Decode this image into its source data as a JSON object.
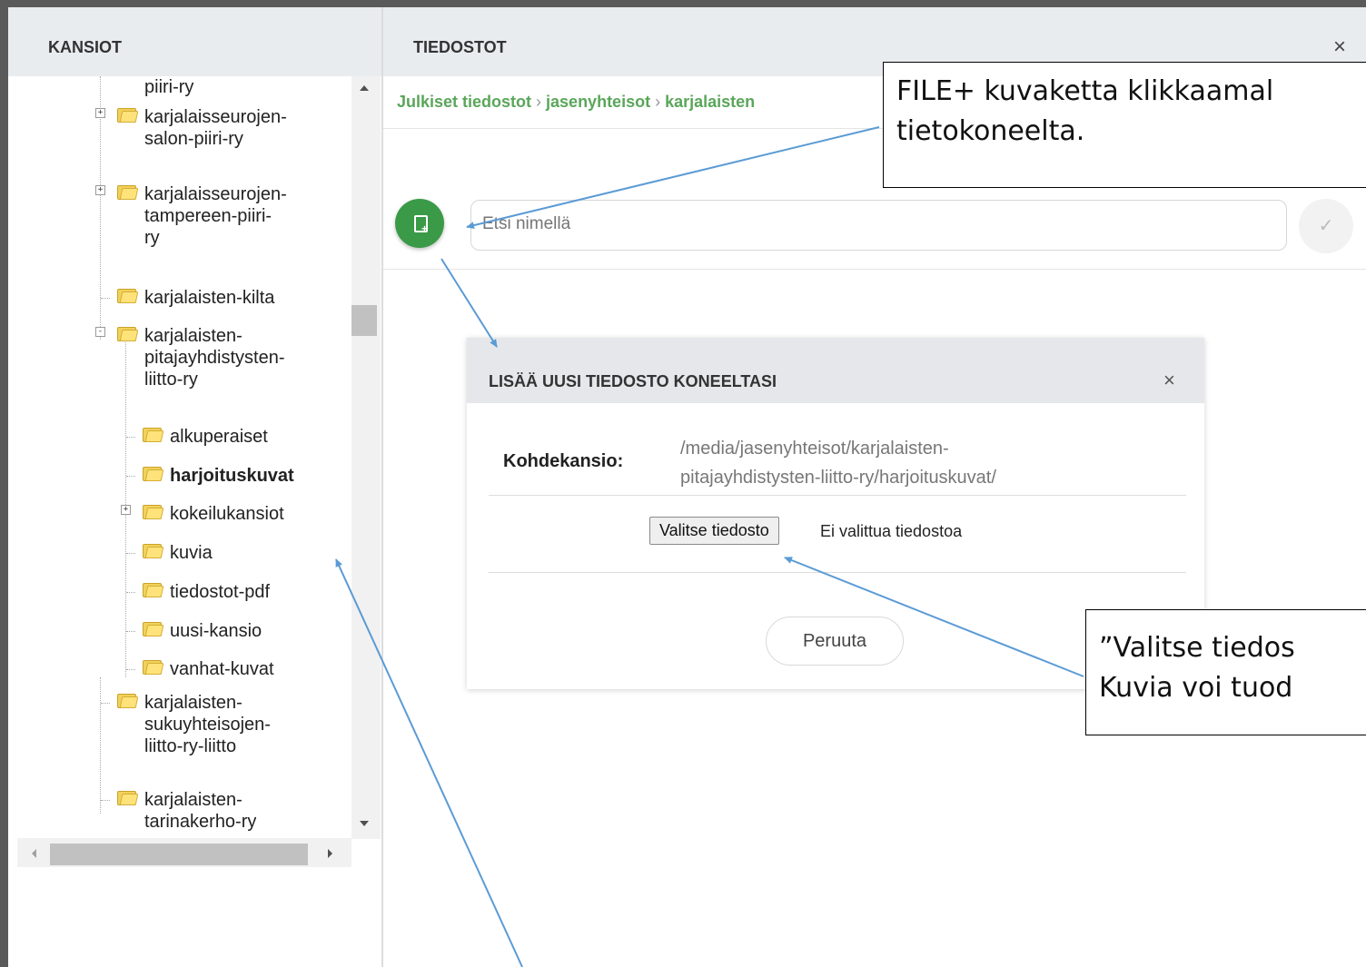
{
  "left_panel": {
    "title": "KANSIOT",
    "tree": [
      {
        "label": "piiri-ry"
      },
      {
        "label": "karjalaisseurojen-salon-piiri-ry",
        "lines": [
          "karjalaisseurojen-",
          "salon-piiri-ry"
        ],
        "expander": "+"
      },
      {
        "label": "karjalaisseurojen-tampereen-piiri-ry",
        "lines": [
          "karjalaisseurojen-",
          "tampereen-piiri-",
          "ry"
        ],
        "expander": "+"
      },
      {
        "label": "karjalaisten-kilta"
      },
      {
        "label": "karjalaisten-pitajayhdistysten-liitto-ry",
        "lines": [
          "karjalaisten-",
          "pitajayhdistysten-",
          "liitto-ry"
        ],
        "expander": "-"
      },
      {
        "label": "alkuperaiset"
      },
      {
        "label": "harjoituskuvat",
        "selected": true
      },
      {
        "label": "kokeilukansiot",
        "expander": "+"
      },
      {
        "label": "kuvia"
      },
      {
        "label": "tiedostot-pdf"
      },
      {
        "label": "uusi-kansio"
      },
      {
        "label": "vanhat-kuvat"
      },
      {
        "label": "karjalaisten-sukuyhteisojen-liitto-ry-liitto",
        "lines": [
          "karjalaisten-",
          "sukuyhteisojen-",
          "liitto-ry-liitto"
        ]
      },
      {
        "label": "karjalaisten-tarinakerho-ry",
        "lines": [
          "karjalaisten-",
          "tarinakerho-ry"
        ]
      }
    ]
  },
  "right_panel": {
    "title": "TIEDOSTOT",
    "close_icon": "×",
    "breadcrumb": [
      "Julkiset tiedostot",
      "jasenyhteisot",
      "karjalaisten"
    ],
    "search_placeholder": "Etsi nimellä",
    "add_file_icon": "file-plus-icon",
    "confirm_icon": "✓"
  },
  "dialog": {
    "title": "LISÄÄ UUSI TIEDOSTO KONEELTASI",
    "close_icon": "×",
    "target_label": "Kohdekansio:",
    "target_path_line1": "/media/jasenyhteisot/karjalaisten-",
    "target_path_line2": "pitajayhdistysten-liitto-ry/harjoituskuvat/",
    "file_button": "Valitse tiedosto",
    "file_status": "Ei valittua tiedostoa",
    "cancel_button": "Peruuta"
  },
  "callouts": {
    "top_line1": "FILE+ kuvaketta klikkaamal",
    "top_line2": "tietokoneelta.",
    "bottom_line1": "”Valitse tiedos",
    "bottom_line2": "Kuvia voi tuod"
  },
  "colors": {
    "accent_green": "#3b9a47",
    "breadcrumb_green": "#5aa65a",
    "header_bg": "#e9ecef",
    "arrow_blue": "#5b9bd5"
  }
}
